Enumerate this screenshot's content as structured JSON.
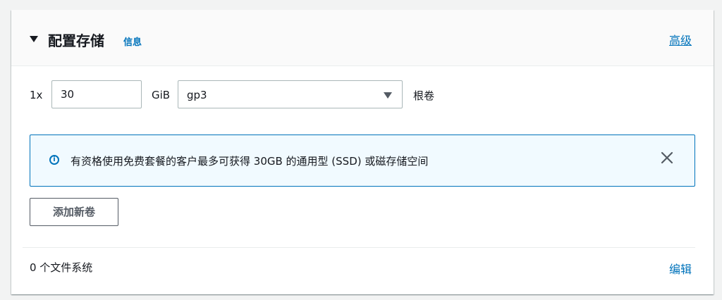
{
  "section": {
    "title": "配置存储",
    "info_label": "信息",
    "advanced_label": "高级"
  },
  "volume": {
    "count_label": "1x",
    "size_value": "30",
    "unit_label": "GiB",
    "type_value": "gp3",
    "root_label": "根卷"
  },
  "alert": {
    "message": "有资格使用免费套餐的客户最多可获得 30GB 的通用型 (SSD) 或磁存储空间",
    "icon": "info-icon"
  },
  "actions": {
    "add_volume_label": "添加新卷"
  },
  "filesystems": {
    "count_label": "0 个文件系统",
    "edit_label": "编辑"
  },
  "colors": {
    "link": "#0073bb",
    "alert_background": "#f1faff",
    "alert_border": "#0073bb"
  }
}
